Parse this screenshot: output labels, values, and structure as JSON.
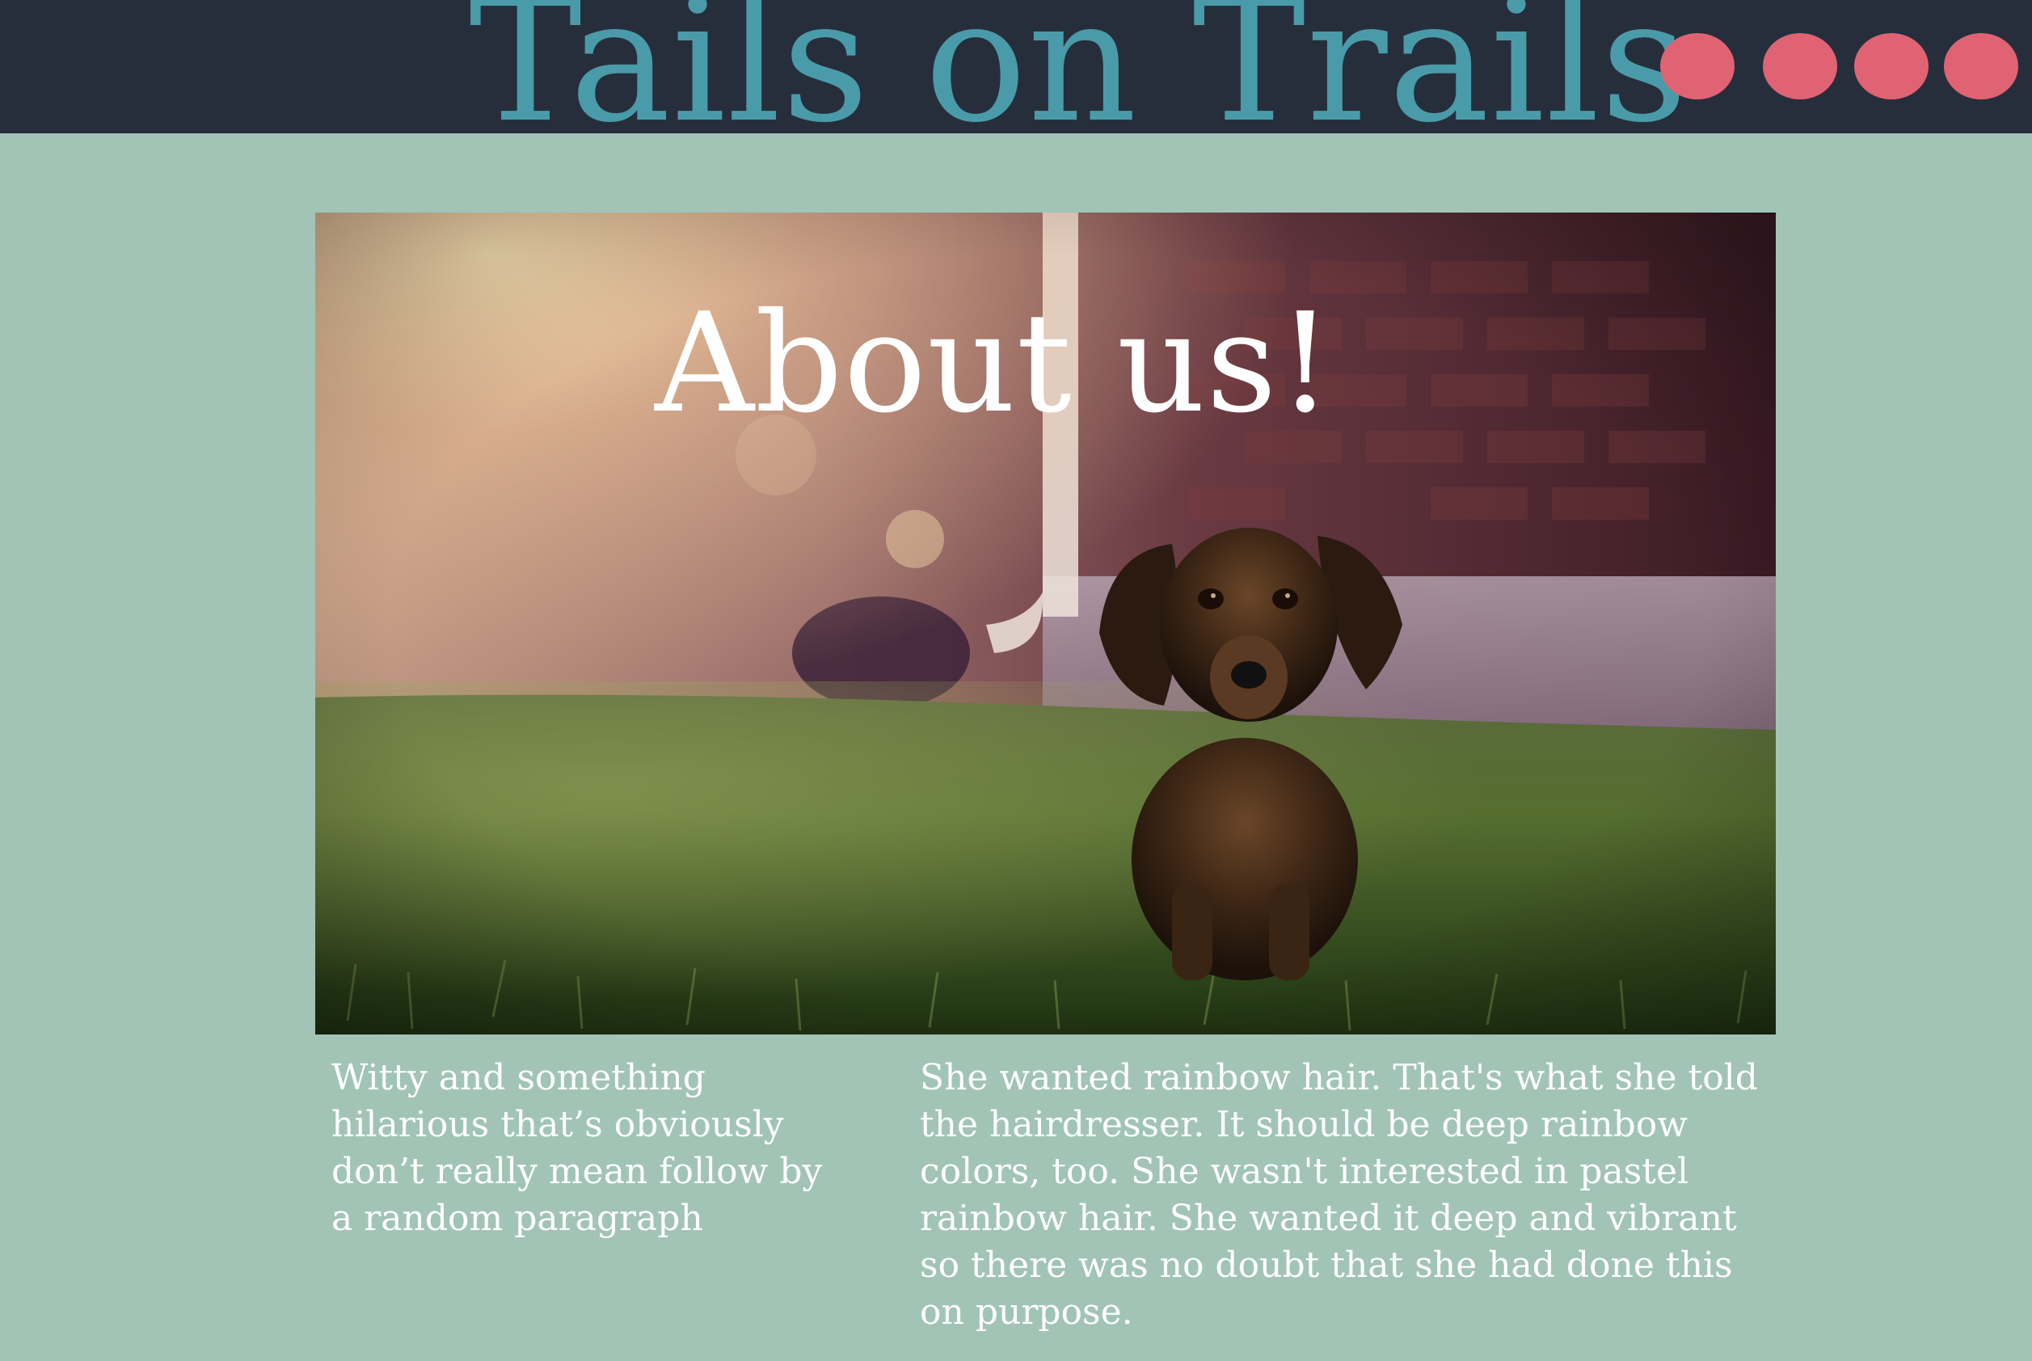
{
  "header": {
    "site_title": "Tails on Trails",
    "nav_buttons": 4
  },
  "hero": {
    "heading": "About us!"
  },
  "content": {
    "left_paragraph": "Witty and something hilarious that’s obviously don’t really mean follow by a random paragraph",
    "right_paragraph": "She wanted rainbow hair. That's what she told the hairdresser. It should be deep rainbow colors, too. She wasn't interested in pastel rainbow hair. She wanted it deep and vibrant so there was no doubt that she had done this on purpose."
  },
  "colors": {
    "page_background": "#a1c4b6",
    "header_background": "#272e3b",
    "title_color": "#4a9ba9",
    "nav_dot_color": "#e06373",
    "text_color": "#ffffff"
  }
}
